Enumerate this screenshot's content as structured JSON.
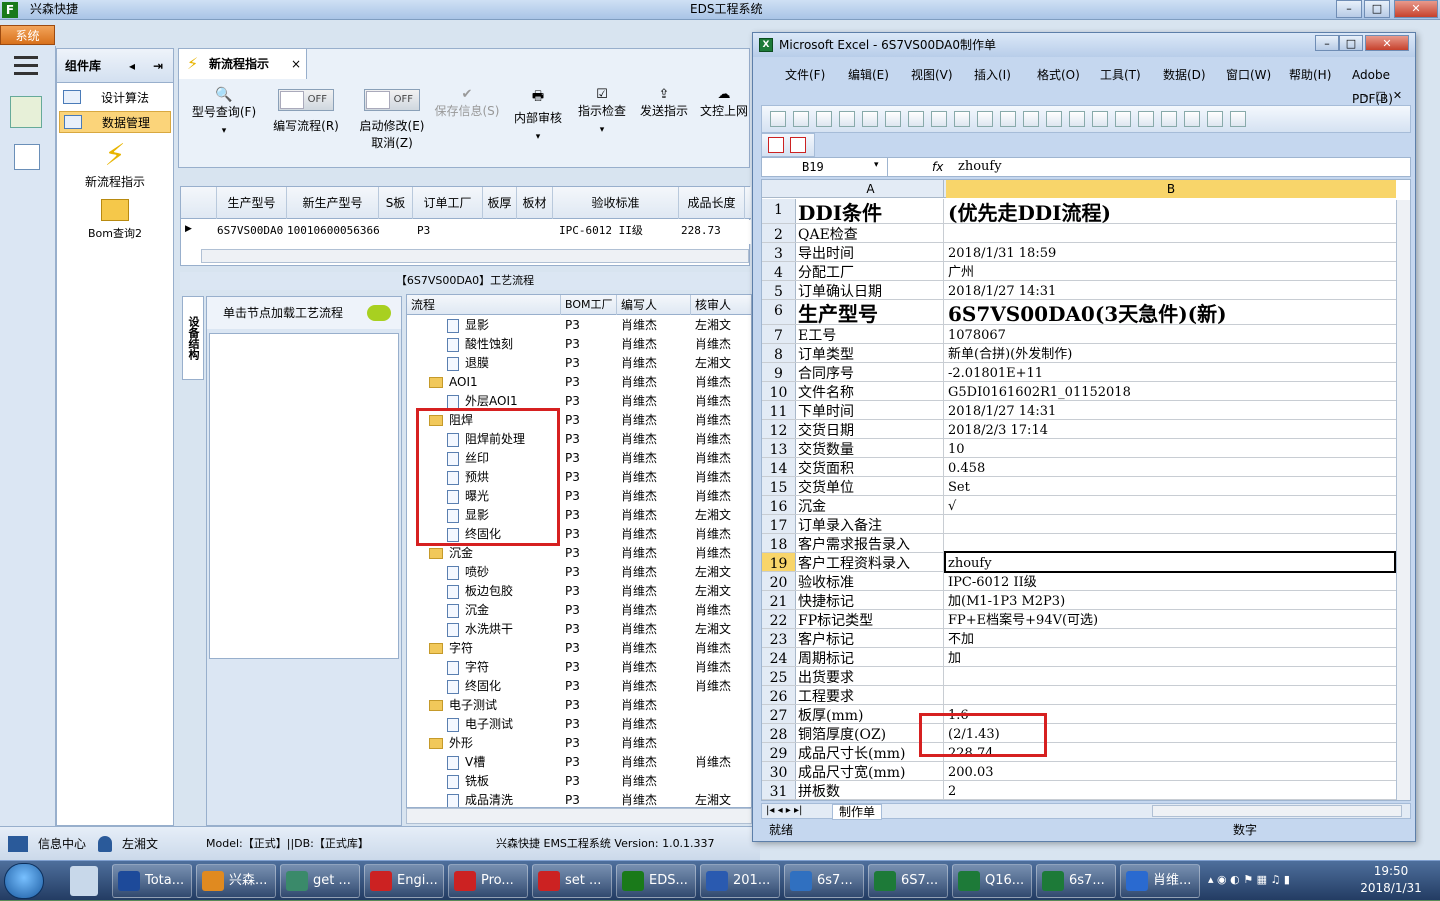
{
  "app": {
    "title": "EDS工程系统",
    "corner_title": "兴森快捷",
    "system_tab": "系统"
  },
  "component_panel": {
    "title": "组件库",
    "items": [
      {
        "label": "设计算法"
      },
      {
        "label": "数据管理"
      }
    ],
    "big_items": [
      {
        "label": "新流程指示"
      },
      {
        "label": "Bom查询2"
      }
    ]
  },
  "ribbon": {
    "tab": "新流程指示",
    "buttons": [
      {
        "label": "型号查询(F)"
      },
      {
        "label": "编写流程(R)",
        "toggle": "OFF"
      },
      {
        "label": "启动修改(E)",
        "toggle": "OFF",
        "sub": "取消(Z)"
      },
      {
        "label": "保存信息(S)"
      },
      {
        "label": "内部审核"
      },
      {
        "label": "指示检查"
      },
      {
        "label": "发送指示"
      },
      {
        "label": "文控上网"
      }
    ]
  },
  "order_grid": {
    "columns": [
      "生产型号",
      "新生产型号",
      "S板",
      "订单工厂",
      "板厚",
      "板材",
      "验收标准",
      "成品长度"
    ],
    "row": [
      "6S7VS00DA0",
      "10010600056366",
      "",
      "P3",
      "",
      "",
      "IPC-6012 II级",
      "228.73"
    ]
  },
  "process": {
    "title": "【6S7VS00DA0】工艺流程",
    "side_tab": "设备结构",
    "node_header": "单击节点加载工艺流程",
    "columns": [
      "流程",
      "BOM工厂",
      "编写人",
      "核审人"
    ],
    "rows": [
      {
        "name": "显影",
        "type": "leaf",
        "factory": "P3",
        "writer": "肖维杰",
        "reviewer": "左湘文"
      },
      {
        "name": "酸性蚀刻",
        "type": "leaf",
        "factory": "P3",
        "writer": "肖维杰",
        "reviewer": "肖维杰"
      },
      {
        "name": "退膜",
        "type": "leaf",
        "factory": "P3",
        "writer": "肖维杰",
        "reviewer": "左湘文"
      },
      {
        "name": "AOI1",
        "type": "group",
        "factory": "P3",
        "writer": "肖维杰",
        "reviewer": "肖维杰"
      },
      {
        "name": "外层AOI1",
        "type": "leaf",
        "factory": "P3",
        "writer": "肖维杰",
        "reviewer": "肖维杰"
      },
      {
        "name": "阻焊",
        "type": "group",
        "factory": "P3",
        "writer": "肖维杰",
        "reviewer": "肖维杰"
      },
      {
        "name": "阻焊前处理",
        "type": "leaf",
        "factory": "P3",
        "writer": "肖维杰",
        "reviewer": "肖维杰"
      },
      {
        "name": "丝印",
        "type": "leaf",
        "factory": "P3",
        "writer": "肖维杰",
        "reviewer": "肖维杰"
      },
      {
        "name": "预烘",
        "type": "leaf",
        "factory": "P3",
        "writer": "肖维杰",
        "reviewer": "肖维杰"
      },
      {
        "name": "曝光",
        "type": "leaf",
        "factory": "P3",
        "writer": "肖维杰",
        "reviewer": "肖维杰"
      },
      {
        "name": "显影",
        "type": "leaf",
        "factory": "P3",
        "writer": "肖维杰",
        "reviewer": "左湘文"
      },
      {
        "name": "终固化",
        "type": "leaf",
        "factory": "P3",
        "writer": "肖维杰",
        "reviewer": "肖维杰"
      },
      {
        "name": "沉金",
        "type": "group",
        "factory": "P3",
        "writer": "肖维杰",
        "reviewer": "肖维杰"
      },
      {
        "name": "喷砂",
        "type": "leaf",
        "factory": "P3",
        "writer": "肖维杰",
        "reviewer": "左湘文"
      },
      {
        "name": "板边包胶",
        "type": "leaf",
        "factory": "P3",
        "writer": "肖维杰",
        "reviewer": "左湘文"
      },
      {
        "name": "沉金",
        "type": "leaf",
        "factory": "P3",
        "writer": "肖维杰",
        "reviewer": "肖维杰"
      },
      {
        "name": "水洗烘干",
        "type": "leaf",
        "factory": "P3",
        "writer": "肖维杰",
        "reviewer": "左湘文"
      },
      {
        "name": "字符",
        "type": "group",
        "factory": "P3",
        "writer": "肖维杰",
        "reviewer": "肖维杰"
      },
      {
        "name": "字符",
        "type": "leaf",
        "factory": "P3",
        "writer": "肖维杰",
        "reviewer": "肖维杰"
      },
      {
        "name": "终固化",
        "type": "leaf",
        "factory": "P3",
        "writer": "肖维杰",
        "reviewer": "肖维杰"
      },
      {
        "name": "电子测试",
        "type": "group",
        "factory": "P3",
        "writer": "肖维杰",
        "reviewer": ""
      },
      {
        "name": "电子测试",
        "type": "leaf",
        "factory": "P3",
        "writer": "肖维杰",
        "reviewer": ""
      },
      {
        "name": "外形",
        "type": "group",
        "factory": "P3",
        "writer": "肖维杰",
        "reviewer": ""
      },
      {
        "name": "V槽",
        "type": "leaf",
        "factory": "P3",
        "writer": "肖维杰",
        "reviewer": "肖维杰"
      },
      {
        "name": "铣板",
        "type": "leaf",
        "factory": "P3",
        "writer": "肖维杰",
        "reviewer": ""
      },
      {
        "name": "成品清洗",
        "type": "leaf",
        "factory": "P3",
        "writer": "肖维杰",
        "reviewer": "左湘文"
      }
    ]
  },
  "statusbar": {
    "info_center": "信息中心",
    "user": "左湘文",
    "model": "Model:【正式】||DB:【正式库】",
    "version": "兴森快捷 EMS工程系统 Version: 1.0.1.337"
  },
  "excel": {
    "title": "Microsoft Excel - 6S7VS00DA0制作单",
    "menu": [
      "文件(F)",
      "编辑(E)",
      "视图(V)",
      "插入(I)",
      "格式(O)",
      "工具(T)",
      "数据(D)",
      "窗口(W)",
      "帮助(H)",
      "Adobe PDF(B)"
    ],
    "cell_ref": "B19",
    "formula": "zhoufy",
    "col_a": "A",
    "col_b": "B",
    "rows": [
      {
        "n": "1",
        "a": "DDI条件",
        "b": "(优先走DDI流程)",
        "big": true
      },
      {
        "n": "2",
        "a": "QAE检查",
        "b": ""
      },
      {
        "n": "3",
        "a": "导出时间",
        "b": "2018/1/31 18:59"
      },
      {
        "n": "4",
        "a": "分配工厂",
        "b": "广州"
      },
      {
        "n": "5",
        "a": "订单确认日期",
        "b": "2018/1/27 14:31"
      },
      {
        "n": "6",
        "a": "生产型号",
        "b": "6S7VS00DA0(3天急件)(新)",
        "big": true
      },
      {
        "n": "7",
        "a": "E工号",
        "b": "1078067"
      },
      {
        "n": "8",
        "a": "订单类型",
        "b": "新单(合拼)(外发制作)"
      },
      {
        "n": "9",
        "a": "合同序号",
        "b": "-2.01801E+11"
      },
      {
        "n": "10",
        "a": "文件名称",
        "b": "G5DI0161602R1_01152018"
      },
      {
        "n": "11",
        "a": "下单时间",
        "b": "2018/1/27 14:31"
      },
      {
        "n": "12",
        "a": "交货日期",
        "b": "2018/2/3 17:14"
      },
      {
        "n": "13",
        "a": "交货数量",
        "b": "10"
      },
      {
        "n": "14",
        "a": "交货面积",
        "b": "0.458"
      },
      {
        "n": "15",
        "a": "交货单位",
        "b": "Set"
      },
      {
        "n": "16",
        "a": "沉金",
        "b": "√"
      },
      {
        "n": "17",
        "a": "订单录入备注",
        "b": ""
      },
      {
        "n": "18",
        "a": "客户需求报告录入",
        "b": ""
      },
      {
        "n": "19",
        "a": "客户工程资料录入",
        "b": "zhoufy",
        "sel": true
      },
      {
        "n": "20",
        "a": "验收标准",
        "b": "IPC-6012 II级"
      },
      {
        "n": "21",
        "a": "快捷标记",
        "b": "加(M1-1P3 M2P3)"
      },
      {
        "n": "22",
        "a": "FP标记类型",
        "b": "FP+E档案号+94V(可选)"
      },
      {
        "n": "23",
        "a": "客户标记",
        "b": "不加"
      },
      {
        "n": "24",
        "a": "周期标记",
        "b": "加"
      },
      {
        "n": "25",
        "a": "出货要求",
        "b": ""
      },
      {
        "n": "26",
        "a": "工程要求",
        "b": ""
      },
      {
        "n": "27",
        "a": "板厚(mm)",
        "b": "1.6"
      },
      {
        "n": "28",
        "a": "铜箔厚度(OZ)",
        "b": "(2/1.43)"
      },
      {
        "n": "29",
        "a": "成品尺寸长(mm)",
        "b": "228.74"
      },
      {
        "n": "30",
        "a": "成品尺寸宽(mm)",
        "b": "200.03"
      },
      {
        "n": "31",
        "a": "拼板数",
        "b": "2"
      }
    ],
    "sheet_tab": "制作单",
    "status_ready": "就绪",
    "status_num": "数字"
  },
  "taskbar": {
    "items": [
      "Tota...",
      "兴森...",
      "get ...",
      "Engi...",
      "Pro...",
      "set ...",
      "EDS...",
      "201...",
      "6s7...",
      "6S7...",
      "Q16...",
      "6s7...",
      "肖维..."
    ],
    "time": "19:50",
    "date": "2018/1/31"
  }
}
